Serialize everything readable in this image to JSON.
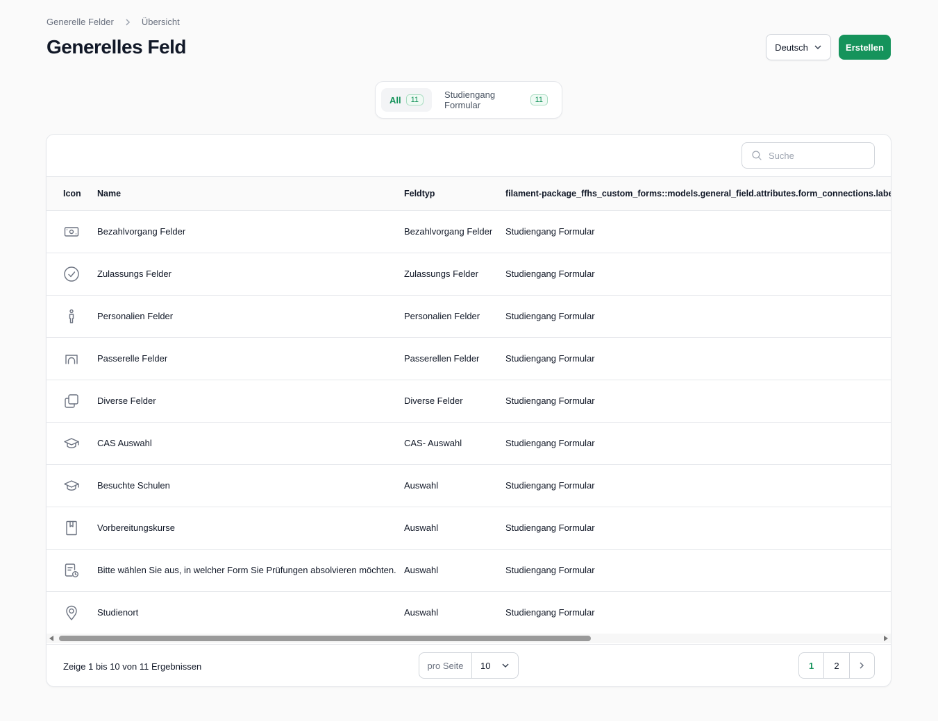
{
  "breadcrumb": {
    "parent": "Generelle Felder",
    "current": "Übersicht"
  },
  "title": "Generelles Feld",
  "header": {
    "language": "Deutsch",
    "create_label": "Erstellen"
  },
  "tabs": [
    {
      "label": "All",
      "count": "11"
    },
    {
      "label": "Studiengang Formular",
      "count": "11"
    }
  ],
  "search": {
    "placeholder": "Suche"
  },
  "columns": {
    "icon": "Icon",
    "name": "Name",
    "type": "Feldtyp",
    "connections": "filament-package_ffhs_custom_forms::models.general_field.attributes.form_connections.label"
  },
  "rows": [
    {
      "icon": "banknote-icon",
      "name": "Bezahlvorgang Felder",
      "type": "Bezahlvorgang Felder",
      "form": "Studiengang Formular"
    },
    {
      "icon": "check-circle-icon",
      "name": "Zulassungs Felder",
      "type": "Zulassungs Felder",
      "form": "Studiengang Formular"
    },
    {
      "icon": "person-icon",
      "name": "Personalien Felder",
      "type": "Personalien Felder",
      "form": "Studiengang Formular"
    },
    {
      "icon": "bridge-icon",
      "name": "Passerelle Felder",
      "type": "Passerellen Felder",
      "form": "Studiengang Formular"
    },
    {
      "icon": "copy-icon",
      "name": "Diverse Felder",
      "type": "Diverse Felder",
      "form": "Studiengang Formular"
    },
    {
      "icon": "graduation-cap-icon",
      "name": "CAS Auswahl",
      "type": "CAS- Auswahl",
      "form": "Studiengang Formular"
    },
    {
      "icon": "graduation-cap-icon",
      "name": "Besuchte Schulen",
      "type": "Auswahl",
      "form": "Studiengang Formular"
    },
    {
      "icon": "book-bookmark-icon",
      "name": "Vorbereitungskurse",
      "type": "Auswahl",
      "form": "Studiengang Formular"
    },
    {
      "icon": "document-clock-icon",
      "name": "Bitte wählen Sie aus, in welcher Form Sie Prüfungen absolvieren möchten.",
      "type": "Auswahl",
      "form": "Studiengang Formular"
    },
    {
      "icon": "map-pin-icon",
      "name": "Studienort",
      "type": "Auswahl",
      "form": "Studiengang Formular"
    }
  ],
  "footer": {
    "results": "Zeige 1 bis 10 von 11 Ergebnissen",
    "per_page_label": "pro Seite",
    "per_page_value": "10",
    "pages": [
      "1",
      "2"
    ]
  },
  "colors": {
    "accent": "#15935b"
  }
}
